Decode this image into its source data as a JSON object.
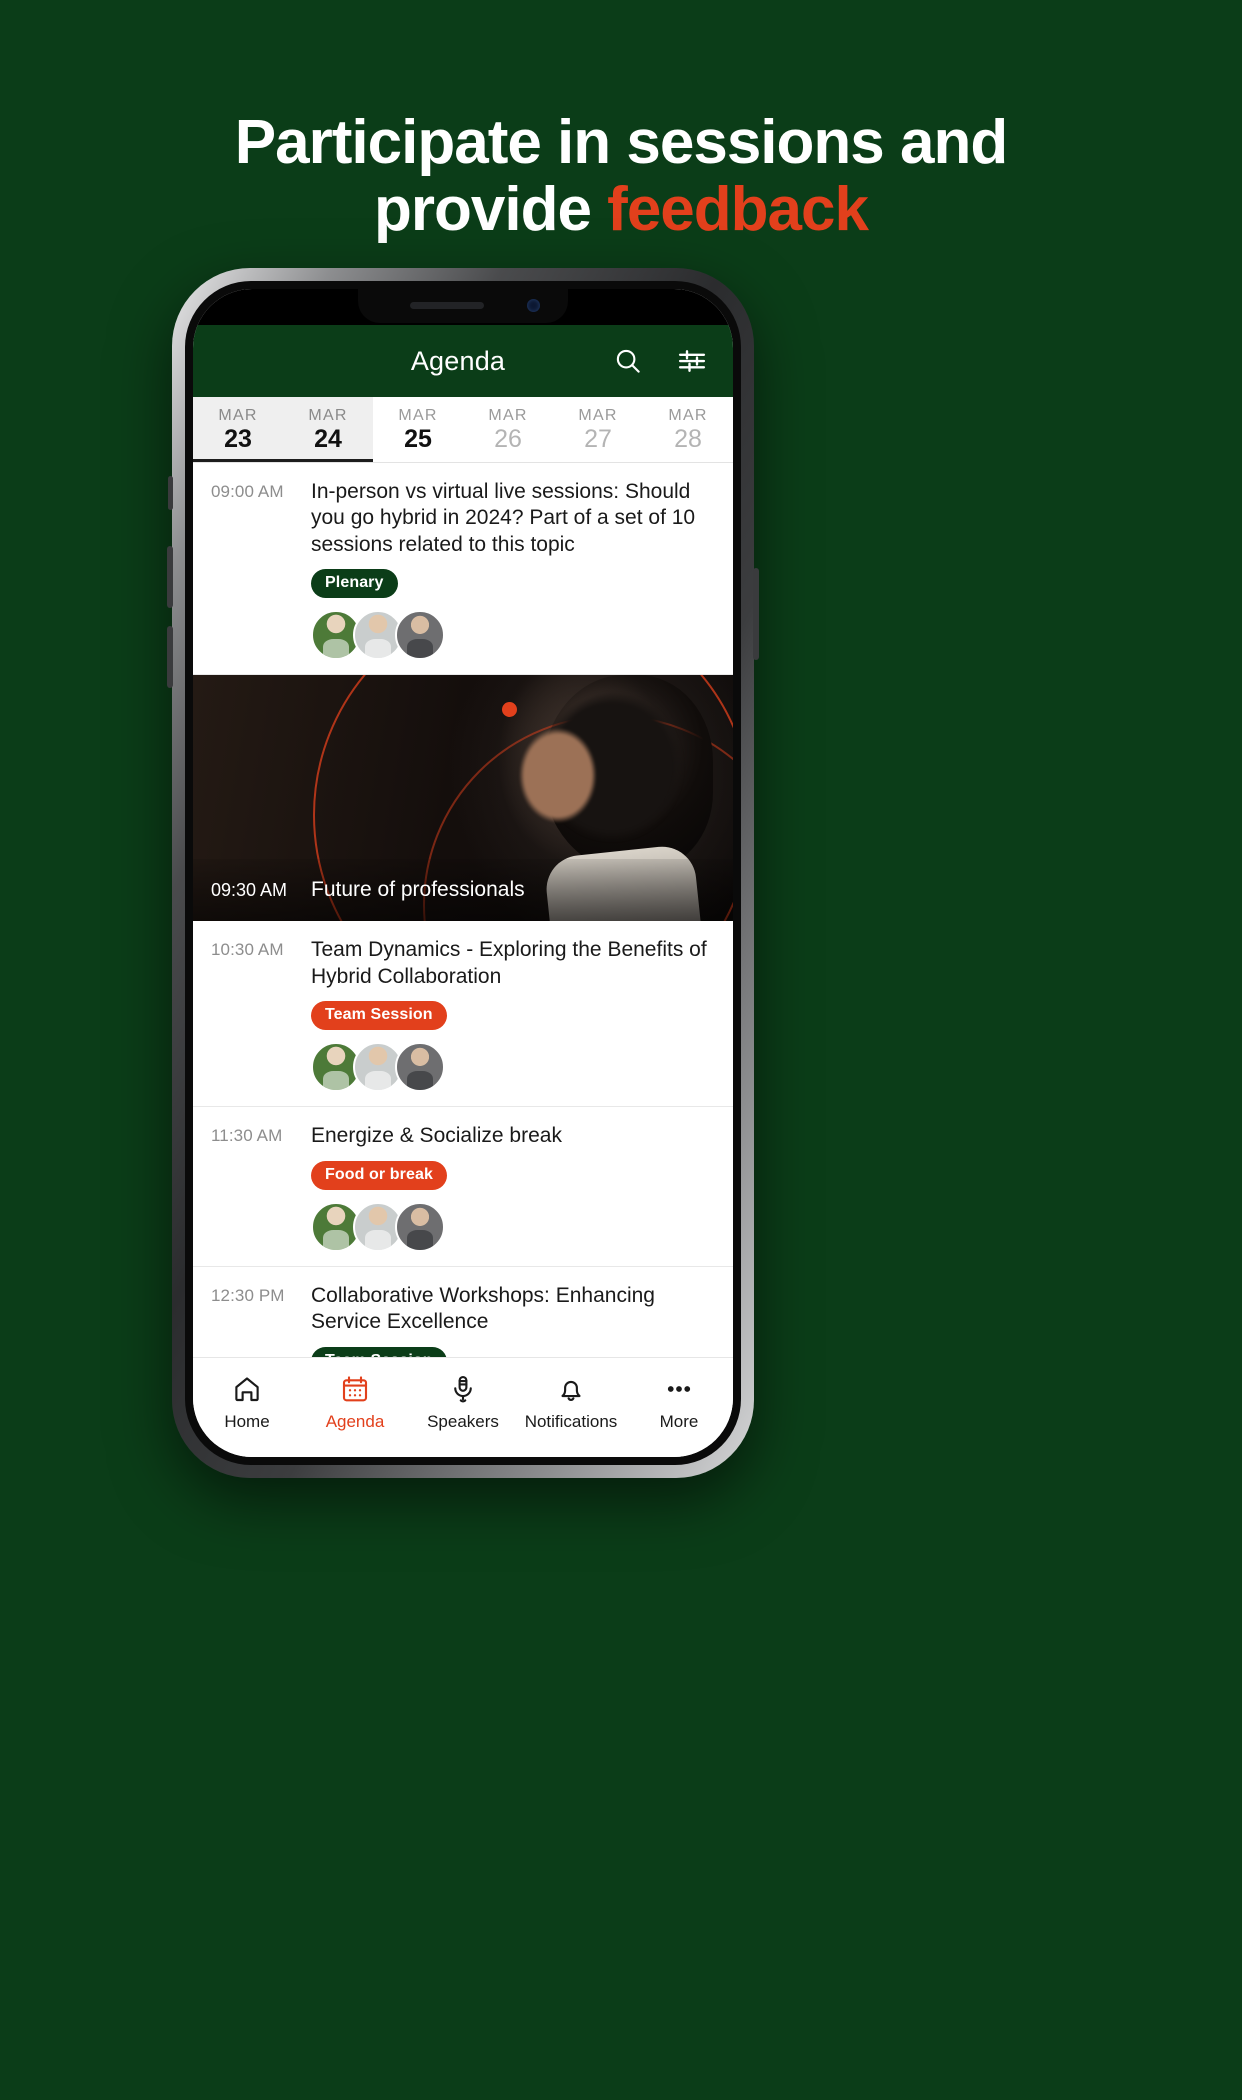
{
  "headline": {
    "line1": "Participate in sessions and",
    "line2_plain": "provide ",
    "line2_accent": "feedback"
  },
  "colors": {
    "background_green": "#0B3D18",
    "accent_orange": "#E2401C",
    "badge_green": "#0B3D18",
    "text_dark": "#1a1a1a"
  },
  "app": {
    "header": {
      "title": "Agenda",
      "search_icon": "search-icon",
      "filter_icon": "filter-sliders-icon"
    },
    "dates": [
      {
        "month": "MAR",
        "day": "23",
        "selected": false,
        "bold": false
      },
      {
        "month": "MAR",
        "day": "24",
        "selected": true,
        "bold": true
      },
      {
        "month": "MAR",
        "day": "25",
        "selected": false,
        "bold": true
      },
      {
        "month": "MAR",
        "day": "26",
        "selected": false,
        "bold": false
      },
      {
        "month": "MAR",
        "day": "27",
        "selected": false,
        "bold": false
      },
      {
        "month": "MAR",
        "day": "28",
        "selected": false,
        "bold": false
      }
    ],
    "sessions": [
      {
        "time": "09:00 AM",
        "title": "In-person vs virtual live sessions: Should you go hybrid in 2024? Part of a set of 10 sessions related to this topic",
        "badge": "Plenary",
        "badge_color": "green",
        "has_avatars": true
      },
      {
        "time": "09:30 AM",
        "title": "Future of professionals",
        "featured": true
      },
      {
        "time": "10:30 AM",
        "title": "Team Dynamics - Exploring the Benefits of Hybrid Collaboration",
        "badge": "Team Session",
        "badge_color": "orange",
        "has_avatars": true
      },
      {
        "time": "11:30 AM",
        "title": "Energize & Socialize break",
        "badge": "Food or break",
        "badge_color": "orange",
        "has_avatars": true
      },
      {
        "time": "12:30 PM",
        "title": "Collaborative Workshops: Enhancing Service Excellence",
        "badge": "Team Session",
        "badge_color": "green",
        "has_avatars": false
      }
    ],
    "bottom_nav": [
      {
        "label": "Home",
        "icon": "home-icon",
        "active": false
      },
      {
        "label": "Agenda",
        "icon": "calendar-icon",
        "active": true
      },
      {
        "label": "Speakers",
        "icon": "microphone-icon",
        "active": false
      },
      {
        "label": "Notifications",
        "icon": "bell-icon",
        "active": false
      },
      {
        "label": "More",
        "icon": "ellipsis-icon",
        "active": false
      }
    ]
  }
}
